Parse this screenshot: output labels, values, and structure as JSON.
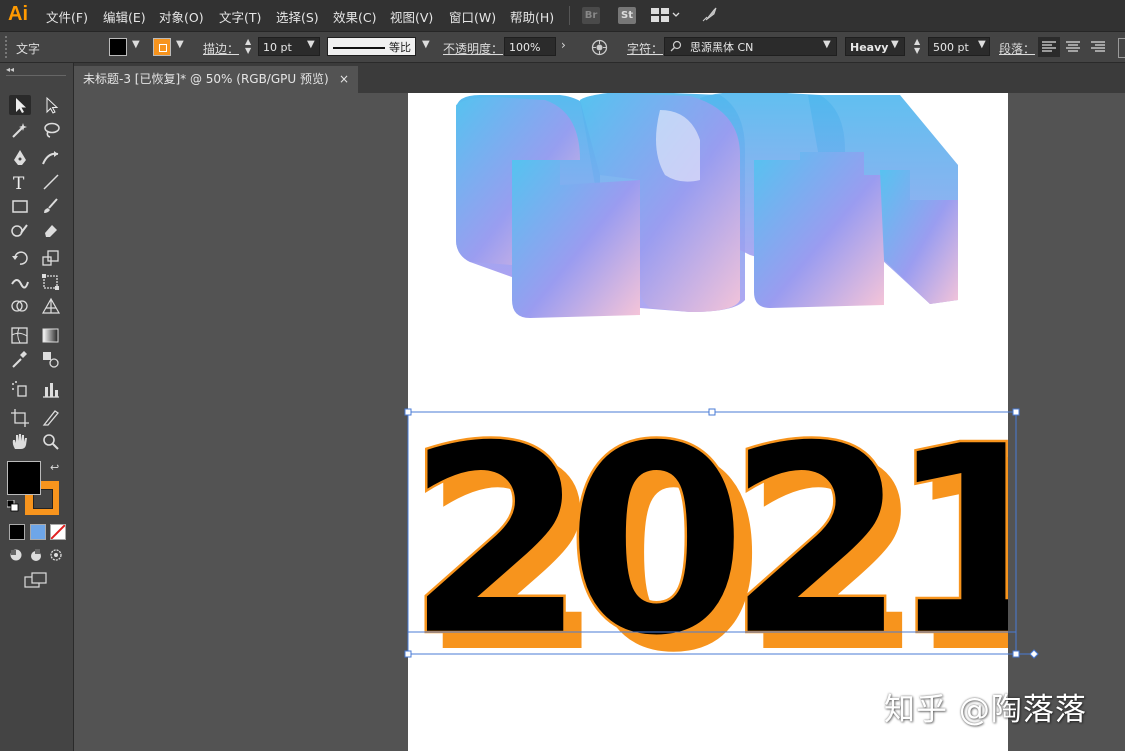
{
  "app": {
    "logo": "Ai"
  },
  "menu": [
    "文件(F)",
    "编辑(E)",
    "对象(O)",
    "文字(T)",
    "选择(S)",
    "效果(C)",
    "视图(V)",
    "窗口(W)",
    "帮助(H)"
  ],
  "menubar_badges": {
    "bridge": "Br",
    "stock": "St"
  },
  "controlbar": {
    "selection_type": "文字",
    "stroke_label": "描边：",
    "stroke_value": "10 pt",
    "stroke_profile": "等比",
    "opacity_label": "不透明度：",
    "opacity_value": "100%",
    "char_label": "字符：",
    "font_family": "思源黑体 CN",
    "font_weight": "Heavy",
    "font_size": "500 pt",
    "para_label": "段落："
  },
  "document_tab": {
    "title": "未标题-3 [已恢复]* @ 50% (RGB/GPU 预览)",
    "close": "×"
  },
  "artwork": {
    "text_3d": "2021",
    "text_flat": "2021"
  },
  "watermark": "知乎 @陶落落",
  "colors": {
    "fill": "#000000",
    "stroke": "#f7941d",
    "gradient_start": "#55c3f0",
    "gradient_mid": "#9a9cf0",
    "gradient_end": "#f6c5d8",
    "selection": "#4a7bd6"
  }
}
